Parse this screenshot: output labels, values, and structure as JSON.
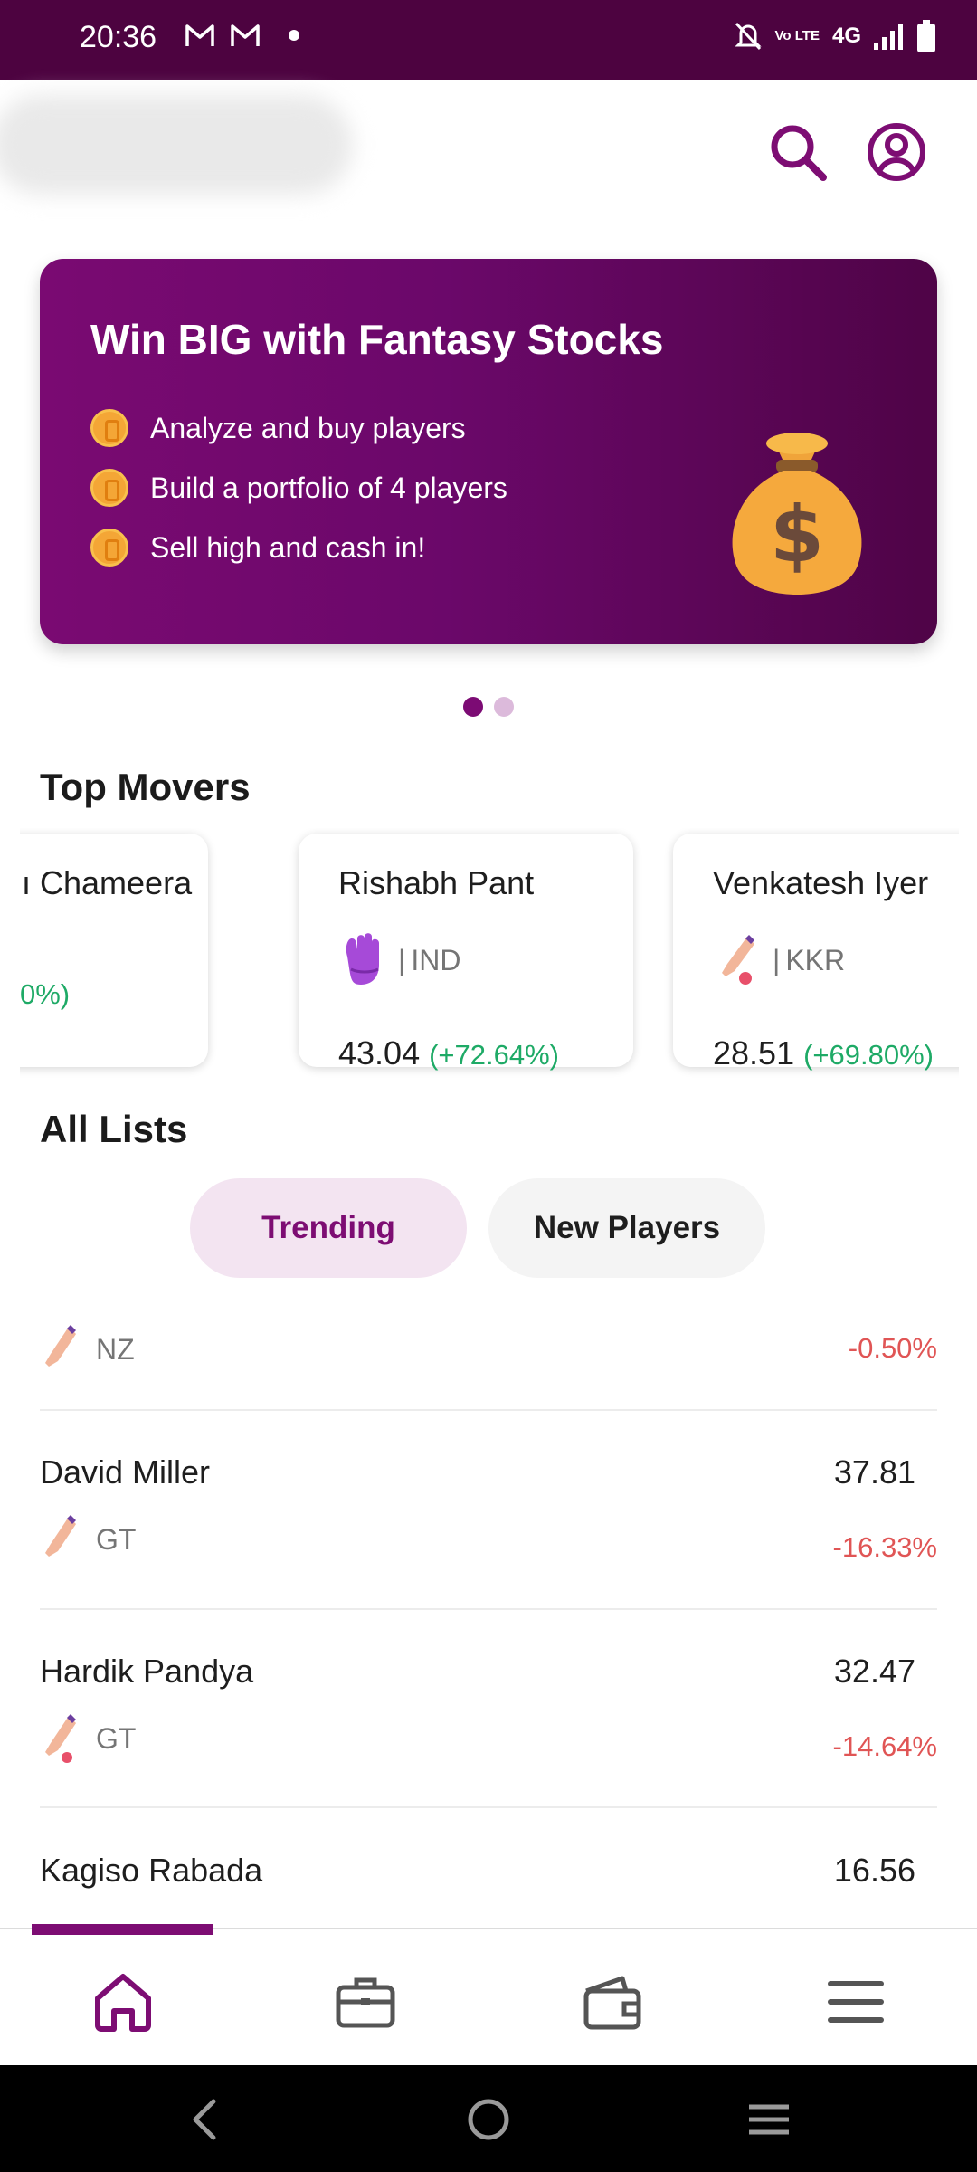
{
  "status_bar": {
    "time": "20:36",
    "network": "4G",
    "lte_label": "Vo LTE",
    "left_icons": [
      "gmail-icon",
      "gmail-icon",
      "notification-dot"
    ],
    "right_icons": [
      "bell-off-icon",
      "volte-icon",
      "signal-icon",
      "battery-icon"
    ]
  },
  "header": {
    "icons": [
      "search-icon",
      "account-circle-icon"
    ]
  },
  "banner": {
    "title": "Win BIG with Fantasy Stocks",
    "points": [
      "Analyze and buy players",
      "Build a portfolio of 4 players",
      "Sell high and cash in!"
    ],
    "illustration": "money-bag-icon",
    "page_count": 2,
    "active_page": 1
  },
  "top_movers": {
    "title": "Top Movers",
    "cards": [
      {
        "name": "Chameera",
        "display_name": "ı Chameera",
        "team": "",
        "price": "",
        "change": "0%)"
      },
      {
        "name": "Rishabh Pant",
        "role_icon": "wicketkeeper-gloves-icon",
        "team": "IND",
        "price": "43.04",
        "change": "(+72.64%)"
      },
      {
        "name": "Venkatesh Iyer",
        "role_icon": "bat-ball-icon",
        "team": "KKR",
        "price": "28.51",
        "change": "(+69.80%)"
      }
    ]
  },
  "all_lists": {
    "title": "All Lists",
    "tabs": [
      {
        "label": "Trending",
        "selected": true
      },
      {
        "label": "New Players",
        "selected": false
      }
    ],
    "rows": [
      {
        "name": "",
        "price": "",
        "team": "NZ",
        "role_icon": "bat-icon",
        "change": "-0.50%"
      },
      {
        "name": "David Miller",
        "price": "37.81",
        "team": "GT",
        "role_icon": "bat-icon",
        "change": "-16.33%"
      },
      {
        "name": "Hardik Pandya",
        "price": "32.47",
        "team": "GT",
        "role_icon": "bat-ball-icon",
        "change": "-14.64%"
      },
      {
        "name": "Kagiso Rabada",
        "price": "16.56",
        "team": "",
        "role_icon": "",
        "change": ""
      }
    ]
  },
  "bottom_nav": {
    "items": [
      "home-icon",
      "briefcase-icon",
      "wallet-icon",
      "menu-icon"
    ],
    "active": "home-icon"
  },
  "system_nav": [
    "back-icon",
    "home-circle-icon",
    "recents-icon"
  ],
  "colors": {
    "brand": "#7d0d73",
    "status_bar": "#4d0340",
    "positive": "#1eaa66",
    "negative": "#e05555",
    "tab_selected_bg": "#f3e4f1"
  }
}
